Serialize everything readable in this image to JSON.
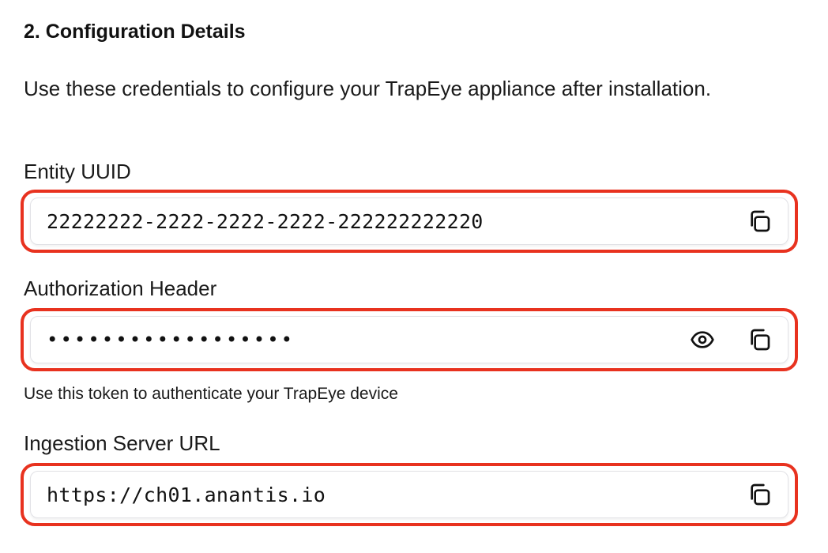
{
  "section": {
    "title": "2. Configuration Details",
    "description": "Use these credentials to configure your TrapEye appliance after installation."
  },
  "fields": {
    "entity_uuid": {
      "label": "Entity UUID",
      "value": "22222222-2222-2222-2222-222222222220",
      "icons": [
        "copy-icon"
      ]
    },
    "authorization_header": {
      "label": "Authorization Header",
      "value": "••••••••••••••••••",
      "icons": [
        "eye-icon",
        "copy-icon"
      ],
      "helper": "Use this token to authenticate your TrapEye device"
    },
    "ingestion_server_url": {
      "label": "Ingestion Server URL",
      "value": "https://ch01.anantis.io",
      "icons": [
        "copy-icon"
      ]
    }
  },
  "colors": {
    "highlight_border": "#e8321f",
    "text": "#111111",
    "field_border": "#e2e2e6"
  }
}
